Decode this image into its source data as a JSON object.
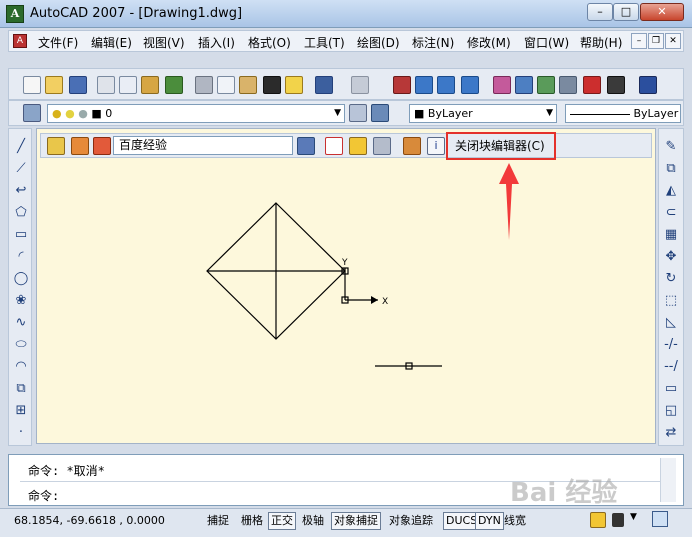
{
  "window": {
    "title": "AutoCAD 2007 - [Drawing1.dwg]",
    "min_glyph": "–",
    "max_glyph": "□",
    "close_glyph": "✕",
    "app_icon_letter": "A"
  },
  "menu": {
    "icon_letter": "A",
    "items": [
      "文件(F)",
      "编辑(E)",
      "视图(V)",
      "插入(I)",
      "格式(O)",
      "工具(T)",
      "绘图(D)",
      "标注(N)",
      "修改(M)",
      "窗口(W)",
      "帮助(H)"
    ],
    "mdi_min": "–",
    "mdi_restore": "❐",
    "mdi_close": "✕"
  },
  "layer_toolbar": {
    "layer_value": "0",
    "color_value": "ByLayer",
    "linetype_value": "ByLayer"
  },
  "block_editor": {
    "block_name": "百度经验",
    "close_button": "关闭块编辑器(C)",
    "info_glyph": "i"
  },
  "drawing": {
    "ucs_y": "Y",
    "ucs_x": "X"
  },
  "command": {
    "line1": "命令: *取消*",
    "line2": "命令:"
  },
  "status": {
    "coords": "68.1854,  -69.6618 , 0.0000",
    "buttons": [
      {
        "label": "捕捉",
        "on": false
      },
      {
        "label": "栅格",
        "on": false
      },
      {
        "label": "正交",
        "on": true
      },
      {
        "label": "极轴",
        "on": false
      },
      {
        "label": "对象捕捉",
        "on": true
      },
      {
        "label": "对象追踪",
        "on": false
      },
      {
        "label": "DUCS",
        "on": true
      },
      {
        "label": "DYN",
        "on": true
      },
      {
        "label": "线宽",
        "on": false
      }
    ]
  },
  "watermark": "Bai 经验",
  "colors": {
    "canvas_bg": "#fdf8dc",
    "highlight": "#e4312b",
    "arrow": "#f23a3a"
  }
}
